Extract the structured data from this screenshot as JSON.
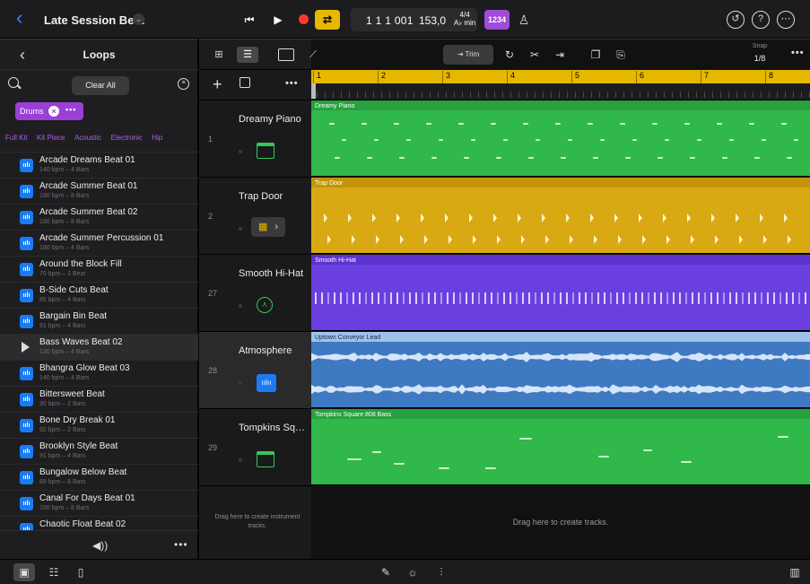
{
  "header": {
    "back_icon": "chevron-left-icon",
    "project_title": "Late Session Beat",
    "transport": {
      "position": "1 1 1 001",
      "tempo": "153,0",
      "signature_top": "4/4",
      "signature_bottom": "A♭ min",
      "count_in": "1234"
    }
  },
  "loops_panel": {
    "title": "Loops",
    "clear_all": "Clear All",
    "active_tag": "Drums",
    "sub_tags": [
      "Full Kit",
      "Kit Piece",
      "Acoustic",
      "Electronic",
      "Hip"
    ],
    "items": [
      {
        "name": "Arcade Dreams Beat 01",
        "meta": "140 bpm – 4 Bars"
      },
      {
        "name": "Arcade Summer Beat 01",
        "meta": "180 bpm – 8 Bars"
      },
      {
        "name": "Arcade Summer Beat 02",
        "meta": "180 bpm – 8 Bars"
      },
      {
        "name": "Arcade Summer Percussion 01",
        "meta": "180 bpm – 4 Bars"
      },
      {
        "name": "Around the Block Fill",
        "meta": "70 bpm – 1 Beat"
      },
      {
        "name": "B-Side Cuts Beat",
        "meta": "85 bpm – 4 Bars"
      },
      {
        "name": "Bargain Bin Beat",
        "meta": "91 bpm – 4 Bars"
      },
      {
        "name": "Bass Waves Beat 02",
        "meta": "130 bpm – 4 Bars"
      },
      {
        "name": "Bhangra Glow Beat 03",
        "meta": "140 bpm – 4 Bars"
      },
      {
        "name": "Bittersweet Beat",
        "meta": "90 bpm – 2 Bars"
      },
      {
        "name": "Bone Dry Break 01",
        "meta": "92 bpm – 2 Bars"
      },
      {
        "name": "Brooklyn Style Beat",
        "meta": "91 bpm – 4 Bars"
      },
      {
        "name": "Bungalow Below Beat",
        "meta": "89 bpm – 8 Bars"
      },
      {
        "name": "Canal For Days Beat 01",
        "meta": "160 bpm – 8 Bars"
      },
      {
        "name": "Chaotic Float Beat 02",
        "meta": ""
      }
    ]
  },
  "tracks": [
    {
      "number": "1",
      "name": "Dreamy Piano",
      "icon": "keyboard-icon",
      "region": "Dreamy Piano",
      "color": "#30b84a"
    },
    {
      "number": "2",
      "name": "Trap Door",
      "icon": "drum-machine-icon",
      "region": "Trap Door",
      "color": "#d8a912"
    },
    {
      "number": "27",
      "name": "Smooth Hi-Hat",
      "icon": "drummer-icon",
      "region": "Smooth Hi-Hat",
      "color": "#6a3fe0"
    },
    {
      "number": "28",
      "name": "Atmosphere",
      "icon": "waveform-icon",
      "region": "Uptown Conveyor Lead",
      "color": "#3f79c2"
    },
    {
      "number": "29",
      "name": "Tompkins Squ...",
      "icon": "keyboard-icon",
      "region": "Tompkins Square 808 Bass",
      "color": "#30b84a"
    }
  ],
  "drag_instrument_hint": "Drag here to create instrument tracks.",
  "drag_tracks_hint": "Drag here to create tracks.",
  "toolbar": {
    "trim_label": "Trim",
    "snap_label": "Snap",
    "snap_value": "1/8"
  },
  "ruler": {
    "bars": [
      "1",
      "2",
      "3",
      "4",
      "5",
      "6",
      "7",
      "8"
    ]
  }
}
